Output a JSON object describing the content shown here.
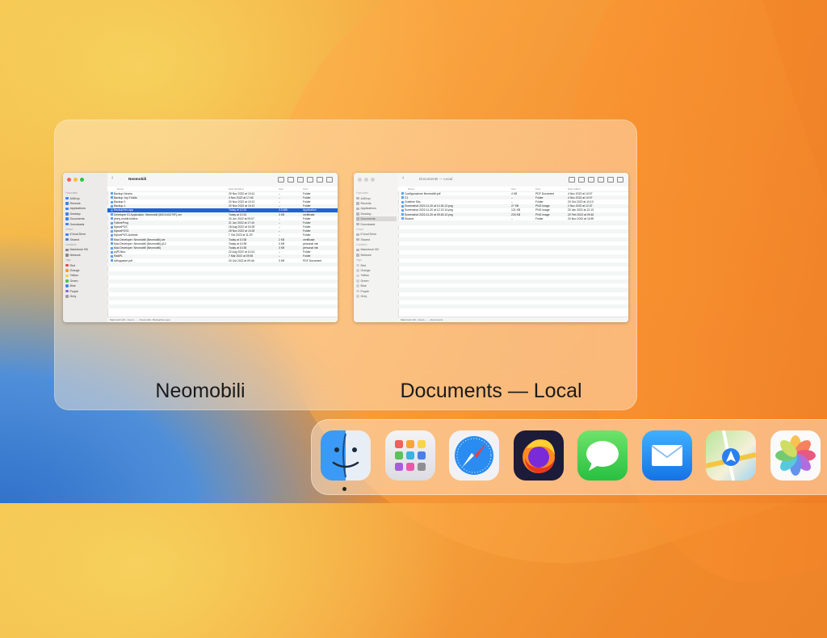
{
  "switcher": {
    "windows": [
      {
        "label": "Neomobili",
        "toolbar_title": "Neomobili",
        "columns": [
          "Name",
          "Date Modified",
          "Size",
          "Kind"
        ],
        "sidebar": [
          {
            "t": "Favourites",
            "h": true
          },
          {
            "t": "AirDrop",
            "c": "#3a83f0"
          },
          {
            "t": "Recents",
            "c": "#3a83f0"
          },
          {
            "t": "Applications",
            "c": "#3a83f0"
          },
          {
            "t": "Desktop",
            "c": "#3a83f0"
          },
          {
            "t": "Documents",
            "c": "#3a83f0"
          },
          {
            "t": "Downloads",
            "c": "#3a83f0"
          },
          {
            "t": "iCloud",
            "h": true
          },
          {
            "t": "iCloud Drive",
            "c": "#3a83f0"
          },
          {
            "t": "Shared",
            "c": "#3a83f0"
          },
          {
            "t": "Locations",
            "h": true
          },
          {
            "t": "Macintosh HD",
            "c": "#888"
          },
          {
            "t": "Network",
            "c": "#888"
          },
          {
            "t": "Tags",
            "h": true
          },
          {
            "t": "Red",
            "dot": "#e8443a"
          },
          {
            "t": "Orange",
            "dot": "#f39a2b"
          },
          {
            "t": "Yellow",
            "dot": "#f4cf3a"
          },
          {
            "t": "Green",
            "dot": "#4cc34a"
          },
          {
            "t": "Blue",
            "dot": "#3a83f0"
          },
          {
            "t": "Purple",
            "dot": "#a05ad8"
          },
          {
            "t": "Grey",
            "dot": "#9a9a9a"
          }
        ],
        "rows": [
          {
            "n": "Backup Neomo",
            "d": "25 Nov 2022 at 10:41",
            "s": "--",
            "k": "Folder"
          },
          {
            "n": "Backup Joy 2 Italia",
            "d": "4 Nov 2022 at 17:46",
            "s": "--",
            "k": "Folder"
          },
          {
            "n": "Backup-0",
            "d": "20 Nov 2022 at 10:13",
            "s": "--",
            "k": "Folder"
          },
          {
            "n": "Backup-1",
            "d": "20 Nov 2022 at 10:13",
            "s": "--",
            "k": "Folder"
          },
          {
            "n": "BackupNeo.app",
            "d": "Today at 12:34",
            "s": "3.5 MB",
            "k": "Application",
            "sel": true
          },
          {
            "n": "Developer ID Application: Neomobili (5KDV4XZ79F).cer",
            "d": "Today at 10:34",
            "s": "3 KB",
            "k": "certificate"
          },
          {
            "n": "jenny-mobili-folders",
            "d": "20 Jun 2022 at 09:07",
            "s": "--",
            "k": "Folder"
          },
          {
            "n": "FattureProg",
            "d": "21 Jun 2022 at 17:44",
            "s": "--",
            "k": "Folder"
          },
          {
            "n": "MyoraPOS",
            "d": "18 Aug 2022 at 15:28",
            "s": "--",
            "k": "Folder"
          },
          {
            "n": "MyoraPOS1",
            "d": "28 Nov 2022 at 10:28",
            "s": "--",
            "k": "Folder"
          },
          {
            "n": "MyoraPOS-Android",
            "d": "7 Oct 2022 at 11:29",
            "s": "--",
            "k": "Folder"
          },
          {
            "n": "Mac Developer: Neomobili (Neomobili).cer",
            "d": "Today at 10:38",
            "s": "2 KB",
            "k": "certificate"
          },
          {
            "n": "Mac Developer: Neomobili (Neomobili).p12",
            "d": "Today at 10:38",
            "s": "3 KB",
            "k": "personal info"
          },
          {
            "n": "Mac Developer: Neomobili (Neomobili)",
            "d": "Today at 10:38",
            "s": "3 KB",
            "k": "personal info"
          },
          {
            "n": "prjPLNeo",
            "d": "22 Aug 2022 at 11:04",
            "s": "--",
            "k": "Folder"
          },
          {
            "n": "RadiPL",
            "d": "7 Mar 2022 at 09:55",
            "s": "--",
            "k": "Folder"
          },
          {
            "n": "sviluppatori.pdf",
            "d": "20 Oct 2022 at 09:46",
            "s": "3 KB",
            "k": "PDF Document"
          }
        ],
        "status": "Macintosh HD › Users › ... › Neomobili › BackupNeo.app"
      },
      {
        "label": "Documents — Local",
        "toolbar_title": "Documents — Local",
        "columns": [
          "Name",
          "Size",
          "Kind",
          "Date Added"
        ],
        "sidebar": [
          {
            "t": "Favourites",
            "h": true
          },
          {
            "t": "AirDrop",
            "c": "#aaa"
          },
          {
            "t": "Recents",
            "c": "#aaa"
          },
          {
            "t": "Applications",
            "c": "#aaa"
          },
          {
            "t": "Desktop",
            "c": "#aaa"
          },
          {
            "t": "Documents",
            "c": "#aaa",
            "sel": true
          },
          {
            "t": "Downloads",
            "c": "#aaa"
          },
          {
            "t": "iCloud",
            "h": true
          },
          {
            "t": "iCloud Drive",
            "c": "#aaa"
          },
          {
            "t": "Shared",
            "c": "#aaa"
          },
          {
            "t": "Locations",
            "h": true
          },
          {
            "t": "Macintosh HD",
            "c": "#aaa"
          },
          {
            "t": "Network",
            "c": "#aaa"
          },
          {
            "t": "Tags",
            "h": true
          },
          {
            "t": "Red",
            "dot": "#c8c8c8"
          },
          {
            "t": "Orange",
            "dot": "#c8c8c8"
          },
          {
            "t": "Yellow",
            "dot": "#c8c8c8"
          },
          {
            "t": "Green",
            "dot": "#c8c8c8"
          },
          {
            "t": "Blue",
            "dot": "#c8c8c8"
          },
          {
            "t": "Purple",
            "dot": "#c8c8c8"
          },
          {
            "t": "Grey",
            "dot": "#c8c8c8"
          }
        ],
        "rows": [
          {
            "n": "Configurazione Neomobili.pdf",
            "d": "4 KB",
            "s": "PDF Document",
            "k": "4 Nov 2022 at 10:07"
          },
          {
            "n": "C1",
            "d": "--",
            "s": "Folder",
            "k": "4 Nov 2022 at 10:07"
          },
          {
            "n": "Grafiche Sito",
            "d": "--",
            "s": "Folder",
            "k": "20 Oct 2022 at 10:13"
          },
          {
            "n": "Screenshot 2022-11-20 at 12.34.12.png",
            "d": "27 KB",
            "s": "PNG image",
            "k": "2 Nov 2022 at 12:37"
          },
          {
            "n": "Screenshot 2022-11-20 at 12.13.14.png",
            "d": "121 KB",
            "s": "PNG image",
            "k": "20 Jan 2022 at 12:13"
          },
          {
            "n": "Screenshot 2022-11-20 at 09.45.12.png",
            "d": "233 KB",
            "s": "PNG image",
            "k": "20 Feb 2023 at 09:46"
          },
          {
            "n": "Shared",
            "d": "--",
            "s": "Folder",
            "k": "20 Nov 2022 at 10:59"
          }
        ],
        "status": "Macintosh HD › Users › ... › Documents"
      }
    ]
  },
  "dock": {
    "apps": [
      {
        "name": "Finder",
        "running": true
      },
      {
        "name": "Launchpad"
      },
      {
        "name": "Safari"
      },
      {
        "name": "Firefox"
      },
      {
        "name": "Messages"
      },
      {
        "name": "Mail"
      },
      {
        "name": "Maps"
      },
      {
        "name": "Photos"
      }
    ]
  }
}
